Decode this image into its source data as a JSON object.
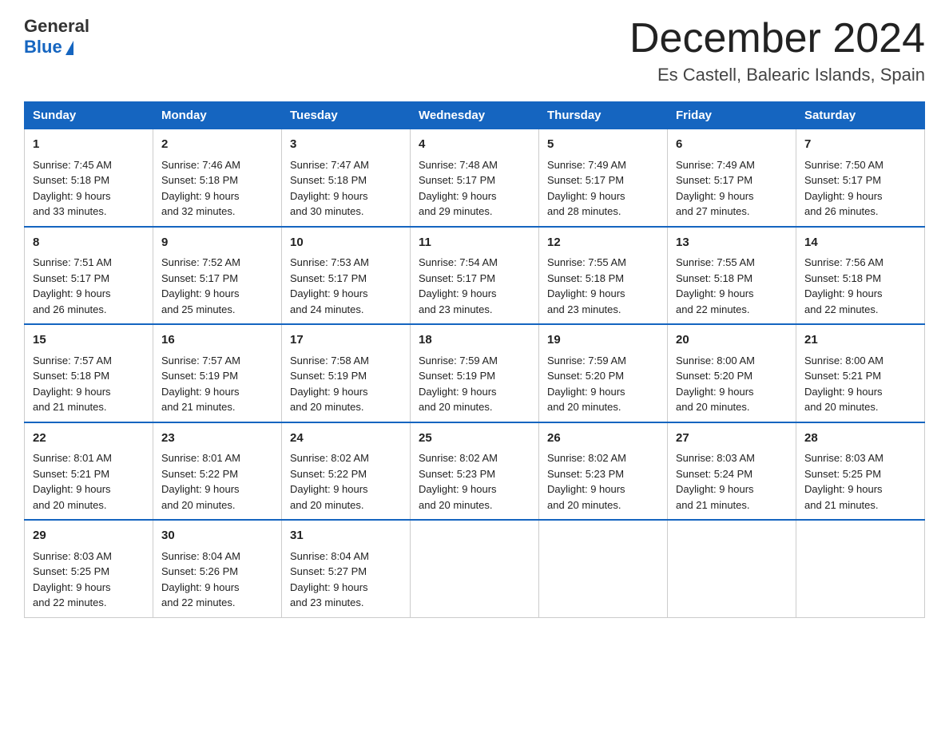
{
  "header": {
    "logo_general": "General",
    "logo_blue": "Blue",
    "month_title": "December 2024",
    "location": "Es Castell, Balearic Islands, Spain"
  },
  "days_of_week": [
    "Sunday",
    "Monday",
    "Tuesday",
    "Wednesday",
    "Thursday",
    "Friday",
    "Saturday"
  ],
  "weeks": [
    [
      {
        "day": "1",
        "sunrise": "7:45 AM",
        "sunset": "5:18 PM",
        "daylight": "9 hours and 33 minutes."
      },
      {
        "day": "2",
        "sunrise": "7:46 AM",
        "sunset": "5:18 PM",
        "daylight": "9 hours and 32 minutes."
      },
      {
        "day": "3",
        "sunrise": "7:47 AM",
        "sunset": "5:18 PM",
        "daylight": "9 hours and 30 minutes."
      },
      {
        "day": "4",
        "sunrise": "7:48 AM",
        "sunset": "5:17 PM",
        "daylight": "9 hours and 29 minutes."
      },
      {
        "day": "5",
        "sunrise": "7:49 AM",
        "sunset": "5:17 PM",
        "daylight": "9 hours and 28 minutes."
      },
      {
        "day": "6",
        "sunrise": "7:49 AM",
        "sunset": "5:17 PM",
        "daylight": "9 hours and 27 minutes."
      },
      {
        "day": "7",
        "sunrise": "7:50 AM",
        "sunset": "5:17 PM",
        "daylight": "9 hours and 26 minutes."
      }
    ],
    [
      {
        "day": "8",
        "sunrise": "7:51 AM",
        "sunset": "5:17 PM",
        "daylight": "9 hours and 26 minutes."
      },
      {
        "day": "9",
        "sunrise": "7:52 AM",
        "sunset": "5:17 PM",
        "daylight": "9 hours and 25 minutes."
      },
      {
        "day": "10",
        "sunrise": "7:53 AM",
        "sunset": "5:17 PM",
        "daylight": "9 hours and 24 minutes."
      },
      {
        "day": "11",
        "sunrise": "7:54 AM",
        "sunset": "5:17 PM",
        "daylight": "9 hours and 23 minutes."
      },
      {
        "day": "12",
        "sunrise": "7:55 AM",
        "sunset": "5:18 PM",
        "daylight": "9 hours and 23 minutes."
      },
      {
        "day": "13",
        "sunrise": "7:55 AM",
        "sunset": "5:18 PM",
        "daylight": "9 hours and 22 minutes."
      },
      {
        "day": "14",
        "sunrise": "7:56 AM",
        "sunset": "5:18 PM",
        "daylight": "9 hours and 22 minutes."
      }
    ],
    [
      {
        "day": "15",
        "sunrise": "7:57 AM",
        "sunset": "5:18 PM",
        "daylight": "9 hours and 21 minutes."
      },
      {
        "day": "16",
        "sunrise": "7:57 AM",
        "sunset": "5:19 PM",
        "daylight": "9 hours and 21 minutes."
      },
      {
        "day": "17",
        "sunrise": "7:58 AM",
        "sunset": "5:19 PM",
        "daylight": "9 hours and 20 minutes."
      },
      {
        "day": "18",
        "sunrise": "7:59 AM",
        "sunset": "5:19 PM",
        "daylight": "9 hours and 20 minutes."
      },
      {
        "day": "19",
        "sunrise": "7:59 AM",
        "sunset": "5:20 PM",
        "daylight": "9 hours and 20 minutes."
      },
      {
        "day": "20",
        "sunrise": "8:00 AM",
        "sunset": "5:20 PM",
        "daylight": "9 hours and 20 minutes."
      },
      {
        "day": "21",
        "sunrise": "8:00 AM",
        "sunset": "5:21 PM",
        "daylight": "9 hours and 20 minutes."
      }
    ],
    [
      {
        "day": "22",
        "sunrise": "8:01 AM",
        "sunset": "5:21 PM",
        "daylight": "9 hours and 20 minutes."
      },
      {
        "day": "23",
        "sunrise": "8:01 AM",
        "sunset": "5:22 PM",
        "daylight": "9 hours and 20 minutes."
      },
      {
        "day": "24",
        "sunrise": "8:02 AM",
        "sunset": "5:22 PM",
        "daylight": "9 hours and 20 minutes."
      },
      {
        "day": "25",
        "sunrise": "8:02 AM",
        "sunset": "5:23 PM",
        "daylight": "9 hours and 20 minutes."
      },
      {
        "day": "26",
        "sunrise": "8:02 AM",
        "sunset": "5:23 PM",
        "daylight": "9 hours and 20 minutes."
      },
      {
        "day": "27",
        "sunrise": "8:03 AM",
        "sunset": "5:24 PM",
        "daylight": "9 hours and 21 minutes."
      },
      {
        "day": "28",
        "sunrise": "8:03 AM",
        "sunset": "5:25 PM",
        "daylight": "9 hours and 21 minutes."
      }
    ],
    [
      {
        "day": "29",
        "sunrise": "8:03 AM",
        "sunset": "5:25 PM",
        "daylight": "9 hours and 22 minutes."
      },
      {
        "day": "30",
        "sunrise": "8:04 AM",
        "sunset": "5:26 PM",
        "daylight": "9 hours and 22 minutes."
      },
      {
        "day": "31",
        "sunrise": "8:04 AM",
        "sunset": "5:27 PM",
        "daylight": "9 hours and 23 minutes."
      },
      null,
      null,
      null,
      null
    ]
  ],
  "labels": {
    "sunrise": "Sunrise:",
    "sunset": "Sunset:",
    "daylight": "Daylight:"
  }
}
